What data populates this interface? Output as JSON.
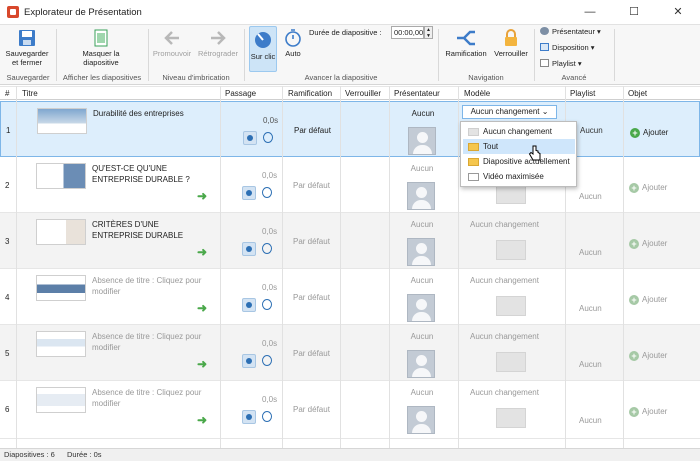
{
  "window": {
    "title": "Explorateur de Présentation",
    "minimize": "—",
    "maximize": "☐",
    "close": "✕"
  },
  "ribbon": {
    "save_btn": "Sauvegarder et fermer",
    "hide_btn": "Masquer la diapositive",
    "promote_btn": "Promouvoir",
    "demote_btn": "Rétrograder",
    "onclick_btn": "Sur clic",
    "auto_btn": "Auto",
    "duration_label": "Durée de diapositive :",
    "duration_value": "00:00,00",
    "branch_btn": "Ramification",
    "lock_btn": "Verrouiller",
    "presenter_menu": "Présentateur",
    "layout_menu": "Disposition",
    "playlist_menu": "Playlist",
    "groups": {
      "save": "Sauvegarder",
      "display": "Afficher les diapositives",
      "nesting": "Niveau d'imbrication",
      "advance": "Avancer la diapositive",
      "navigation": "Navigation",
      "advanced": "Avancé"
    }
  },
  "table": {
    "headers": [
      "#",
      "Titre",
      "Passage",
      "Ramification",
      "Verrouiller",
      "Présentateur",
      "Modèle",
      "Playlist",
      "Objet"
    ],
    "rows": [
      {
        "num": "1",
        "title": "Durabilité des entreprises",
        "time": "0,0s",
        "branch": "Par défaut",
        "presenter": "Aucun",
        "model": "Aucun changement",
        "playlist": "Aucun",
        "object": "Ajouter"
      },
      {
        "num": "2",
        "title": "QU'EST-CE QU'UNE ENTREPRISE DURABLE ?",
        "time": "0,0s",
        "branch": "Par défaut",
        "presenter": "Aucun",
        "model": "Aucun changement",
        "playlist": "Aucun",
        "object": "Ajouter"
      },
      {
        "num": "3",
        "title": "CRITÈRES D'UNE ENTREPRISE DURABLE",
        "time": "0,0s",
        "branch": "Par défaut",
        "presenter": "Aucun",
        "model": "Aucun changement",
        "playlist": "Aucun",
        "object": "Ajouter"
      },
      {
        "num": "4",
        "title": "Absence de titre : Cliquez pour modifier",
        "time": "0,0s",
        "branch": "Par défaut",
        "presenter": "Aucun",
        "model": "Aucun changement",
        "playlist": "Aucun",
        "object": "Ajouter"
      },
      {
        "num": "5",
        "title": "Absence de titre : Cliquez pour modifier",
        "time": "0,0s",
        "branch": "Par défaut",
        "presenter": "Aucun",
        "model": "Aucun changement",
        "playlist": "Aucun",
        "object": "Ajouter"
      },
      {
        "num": "6",
        "title": "Absence de titre : Cliquez pour modifier",
        "time": "0,0s",
        "branch": "Par défaut",
        "presenter": "Aucun",
        "model": "Aucun changement",
        "playlist": "Aucun",
        "object": "Ajouter"
      }
    ]
  },
  "dropdown": {
    "selected": "Aucun changement",
    "options": [
      "Aucun changement",
      "Tout",
      "Diapositive actuellement",
      "Vidéo maximisée"
    ]
  },
  "status": {
    "slides": "Diapositives : 6",
    "duration": "Durée :  0s"
  }
}
